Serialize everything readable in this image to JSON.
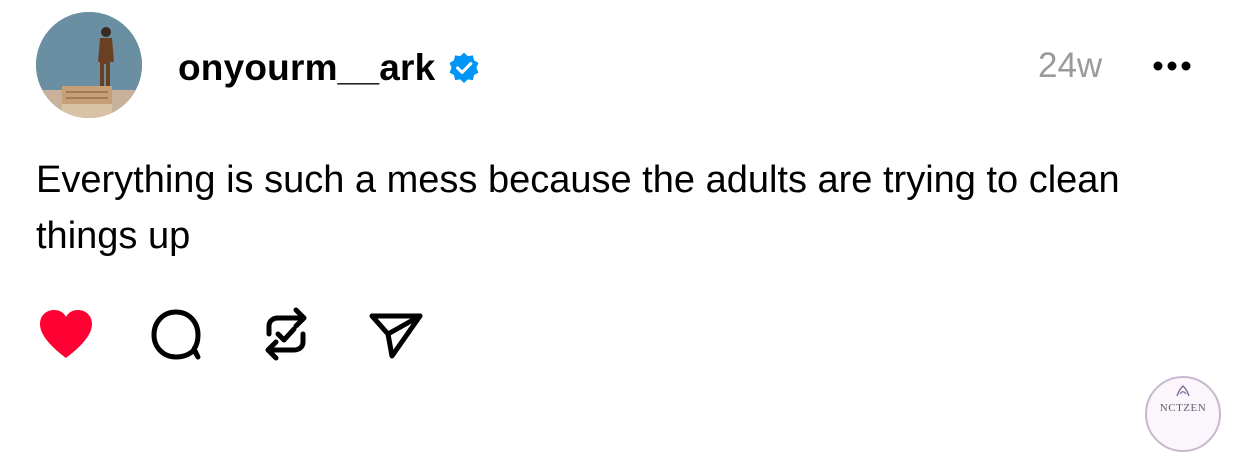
{
  "post": {
    "username": "onyourm__ark",
    "verified": true,
    "time": "24w",
    "text": "Everything is such a mess because the adults are trying to clean things up"
  },
  "actions": {
    "like_icon": "heart-filled-icon",
    "reply_icon": "comment-icon",
    "repost_icon": "repost-check-icon",
    "share_icon": "send-icon",
    "liked": true
  },
  "colors": {
    "like": "#ff0033",
    "verified": "#0095f6",
    "muted": "#9a9a9a"
  },
  "watermark": {
    "text": "NCTZEN"
  }
}
